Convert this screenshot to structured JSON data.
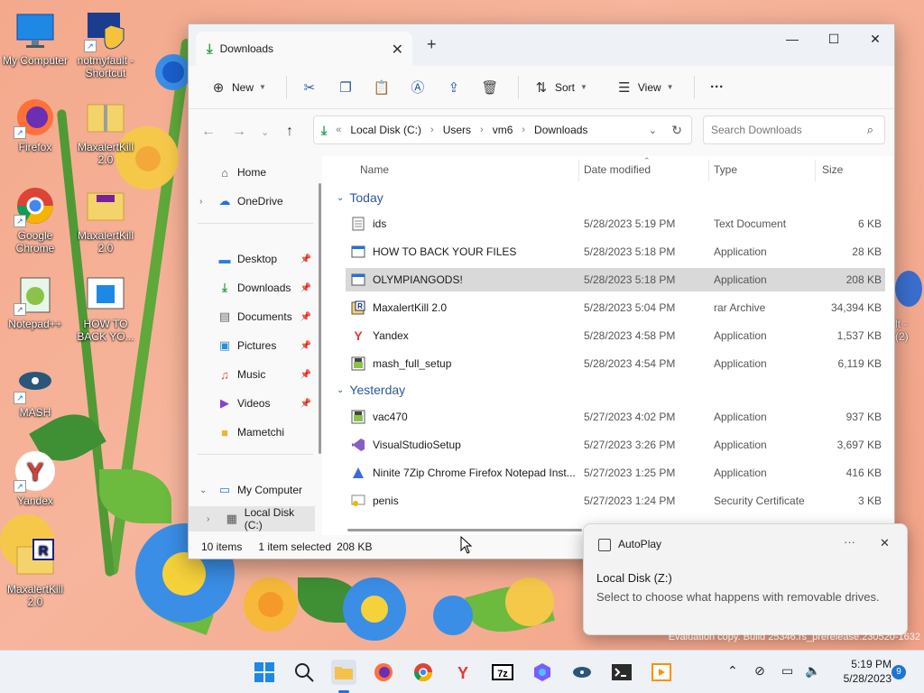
{
  "desktop": {
    "icons": [
      {
        "label": "My Computer"
      },
      {
        "label": "notmyfault - Shortcut"
      },
      {
        "label": "Firefox"
      },
      {
        "label": "MaxalertKill 2.0"
      },
      {
        "label": "Google Chrome"
      },
      {
        "label": "MaxalertKill 2.0"
      },
      {
        "label": "Notepad++"
      },
      {
        "label": "HOW TO BACK YO..."
      },
      {
        "label": "MASH"
      },
      {
        "label": "Yandex"
      },
      {
        "label": "MaxalertKill 2.0"
      }
    ],
    "partial_right_text": "lt -",
    "partial_right_text2": "(2)",
    "watermark": "Evaluation copy. Build 25346.rs_prerelease.230520-1632"
  },
  "explorer": {
    "tab_title": "Downloads",
    "toolbar": {
      "new_label": "New",
      "sort_label": "Sort",
      "view_label": "View"
    },
    "breadcrumb": [
      "Local Disk (C:)",
      "Users",
      "vm6",
      "Downloads"
    ],
    "search_placeholder": "Search Downloads",
    "nav": {
      "home": "Home",
      "onedrive": "OneDrive",
      "desktop": "Desktop",
      "downloads": "Downloads",
      "documents": "Documents",
      "pictures": "Pictures",
      "music": "Music",
      "videos": "Videos",
      "mametchi": "Mametchi",
      "mycomputer": "My Computer",
      "localdisk": "Local Disk (C:)"
    },
    "columns": {
      "name": "Name",
      "date": "Date modified",
      "type": "Type",
      "size": "Size"
    },
    "groups": {
      "today": "Today",
      "yesterday": "Yesterday"
    },
    "files_today": [
      {
        "name": "ids",
        "date": "5/28/2023 5:19 PM",
        "type": "Text Document",
        "size": "6 KB",
        "icon": "text-file-icon"
      },
      {
        "name": "HOW TO BACK YOUR FILES",
        "date": "5/28/2023 5:18 PM",
        "type": "Application",
        "size": "28 KB",
        "icon": "app-window-icon"
      },
      {
        "name": "OLYMPIANGODS!",
        "date": "5/28/2023 5:18 PM",
        "type": "Application",
        "size": "208 KB",
        "icon": "app-window-icon",
        "selected": true
      },
      {
        "name": "MaxalertKill 2.0",
        "date": "5/28/2023 5:04 PM",
        "type": "rar Archive",
        "size": "34,394 KB",
        "icon": "rar-icon"
      },
      {
        "name": "Yandex",
        "date": "5/28/2023 4:58 PM",
        "type": "Application",
        "size": "1,537 KB",
        "icon": "yandex-icon"
      },
      {
        "name": "mash_full_setup",
        "date": "5/28/2023 4:54 PM",
        "type": "Application",
        "size": "6,119 KB",
        "icon": "installer-icon"
      }
    ],
    "files_yesterday": [
      {
        "name": "vac470",
        "date": "5/27/2023 4:02 PM",
        "type": "Application",
        "size": "937 KB",
        "icon": "installer-icon"
      },
      {
        "name": "VisualStudioSetup",
        "date": "5/27/2023 3:26 PM",
        "type": "Application",
        "size": "3,697 KB",
        "icon": "visual-studio-icon"
      },
      {
        "name": "Ninite 7Zip Chrome Firefox Notepad Inst...",
        "date": "5/27/2023 1:25 PM",
        "type": "Application",
        "size": "416 KB",
        "icon": "ninite-icon"
      },
      {
        "name": "penis",
        "date": "5/27/2023 1:24 PM",
        "type": "Security Certificate",
        "size": "3 KB",
        "icon": "certificate-icon"
      }
    ],
    "status": {
      "count": "10 items",
      "selection": "1 item selected",
      "size": "208 KB"
    }
  },
  "toast": {
    "app": "AutoPlay",
    "title": "Local Disk (Z:)",
    "body": "Select to choose what happens with removable drives."
  },
  "taskbar": {
    "time": "5:19 PM",
    "date": "5/28/2023",
    "notifications": "9"
  },
  "colors": {
    "accent": "#2b5a9e",
    "selected_row": "#d9d9d9",
    "wallpaper": "#f4a98c"
  }
}
